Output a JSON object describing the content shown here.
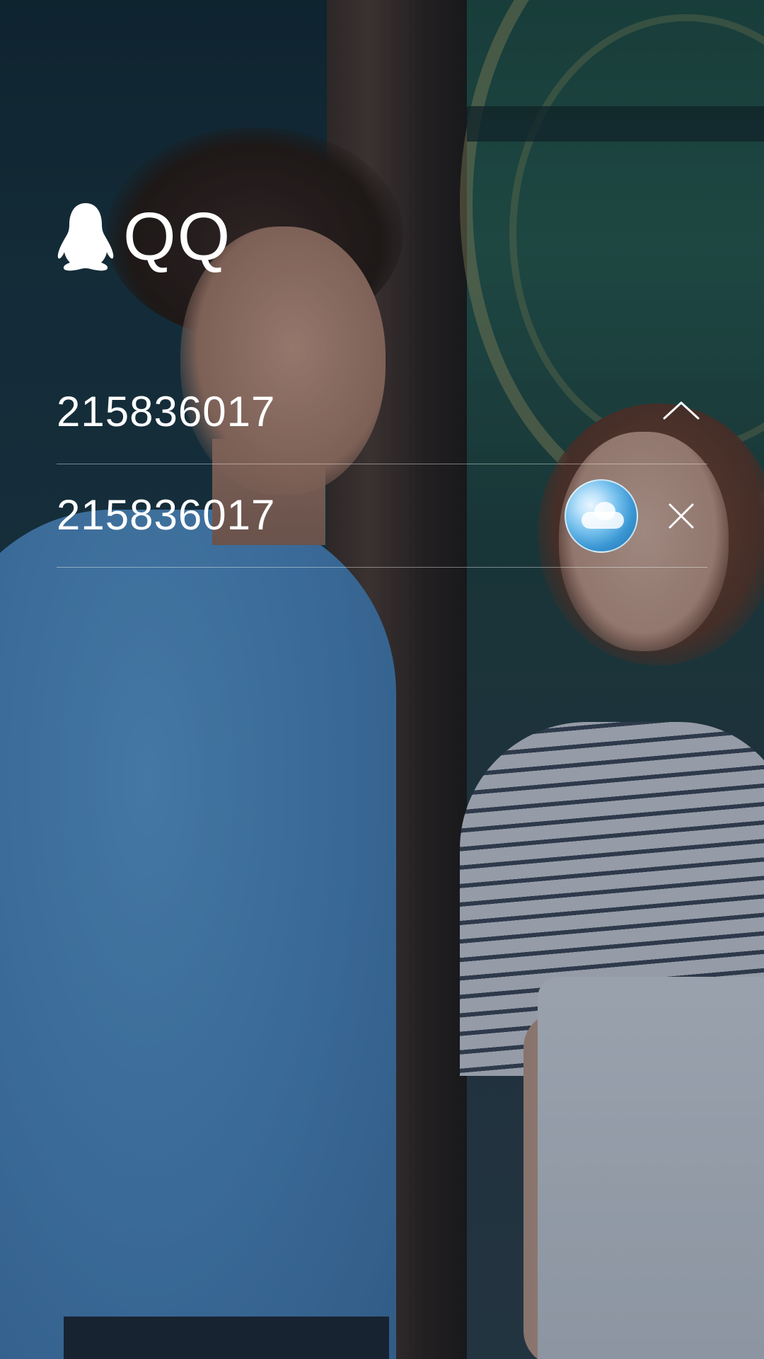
{
  "app": {
    "logo_text": "QQ",
    "logo_icon": "penguin-icon"
  },
  "login": {
    "account_field": {
      "value": "215836017",
      "toggle_icon": "chevron-up-icon"
    },
    "account_dropdown": {
      "items": [
        {
          "account": "215836017",
          "avatar_icon": "sky-avatar",
          "remove_icon": "close-icon"
        }
      ]
    }
  },
  "colors": {
    "text": "#ffffff",
    "divider": "rgba(255,255,255,0.42)"
  }
}
